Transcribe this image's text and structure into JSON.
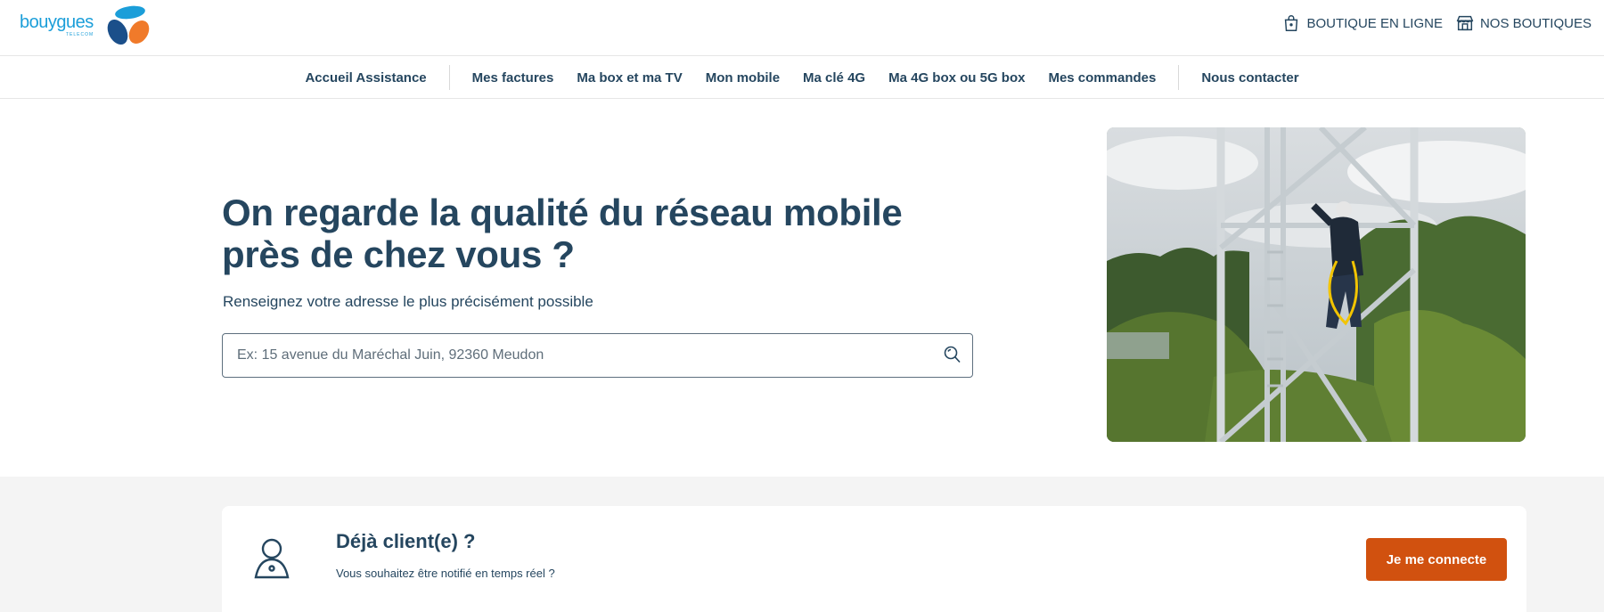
{
  "header": {
    "logo": {
      "text": "bouygues",
      "subtext": "TELECOM",
      "icon": "bouygues-logo-icon"
    },
    "links": [
      {
        "label": "BOUTIQUE EN LIGNE",
        "icon": "shopping-bag-icon"
      },
      {
        "label": "NOS BOUTIQUES",
        "icon": "store-icon"
      }
    ]
  },
  "nav": {
    "items": [
      "Accueil Assistance",
      "Mes factures",
      "Ma box et ma TV",
      "Mon mobile",
      "Ma clé 4G",
      "Ma 4G box ou 5G box",
      "Mes commandes",
      "Nous contacter"
    ]
  },
  "hero": {
    "title": "On regarde la qualité du réseau mobile près de chez vous ?",
    "subtitle": "Renseignez votre adresse le plus précisément possible",
    "search": {
      "placeholder": "Ex: 15 avenue du Maréchal Juin, 92360 Meudon",
      "value": "",
      "icon": "search-icon"
    },
    "image": {
      "subject": "technician-climbing-antenna-tower"
    }
  },
  "client": {
    "icon": "user-icon",
    "title": "Déjà client(e) ?",
    "subtitle": "Vous souhaitez être notifié en temps réel ?",
    "button_label": "Je me connecte"
  },
  "colors": {
    "primary_text": "#25465f",
    "brand_blue": "#1b9ed9",
    "brand_navy": "#1b4f8a",
    "brand_orange": "#f07a2a",
    "cta": "#d1510f",
    "section_bg": "#f4f4f4"
  }
}
